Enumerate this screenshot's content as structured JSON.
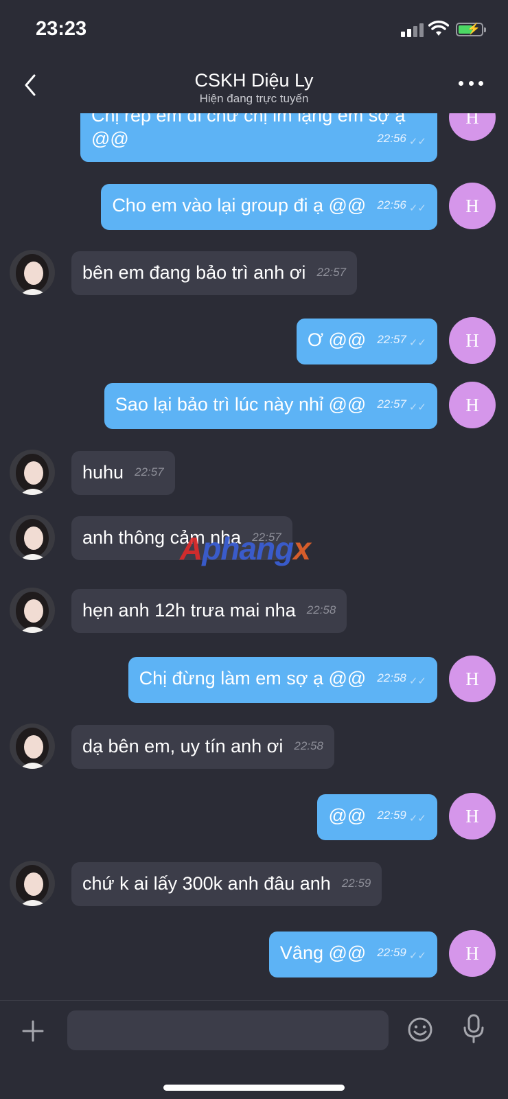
{
  "status_bar": {
    "time": "23:23"
  },
  "header": {
    "title": "CSKH Diệu Ly",
    "subtitle": "Hiện đang trực tuyến"
  },
  "messages": [
    {
      "side": "out",
      "text_line1": "Chị rep em đi chứ chị im lặng em sợ ạ",
      "text_line2": "@@",
      "time": "22:56",
      "avatar": "H"
    },
    {
      "side": "out",
      "text": "Cho em vào lại group đi ạ @@",
      "time": "22:56",
      "avatar": "H"
    },
    {
      "side": "in",
      "text": "bên em đang bảo trì anh ơi",
      "time": "22:57"
    },
    {
      "side": "out",
      "text": "Ơ @@",
      "time": "22:57",
      "avatar": "H"
    },
    {
      "side": "out",
      "text": "Sao lại bảo trì lúc này nhỉ @@",
      "time": "22:57",
      "avatar": "H"
    },
    {
      "side": "in",
      "text": "huhu",
      "time": "22:57"
    },
    {
      "side": "in",
      "text": "anh thông cảm nha",
      "time": "22:57"
    },
    {
      "side": "in",
      "text": "hẹn anh 12h trưa mai nha",
      "time": "22:58"
    },
    {
      "side": "out",
      "text": "Chị đừng làm em sợ ạ @@",
      "time": "22:58",
      "avatar": "H"
    },
    {
      "side": "in",
      "text": "dạ bên em, uy tín anh ơi",
      "time": "22:58"
    },
    {
      "side": "out",
      "text": "@@",
      "time": "22:59",
      "avatar": "H"
    },
    {
      "side": "in",
      "text": "chứ k ai lấy 300k anh đâu anh",
      "time": "22:59"
    },
    {
      "side": "out",
      "text": "Vâng @@",
      "time": "22:59",
      "avatar": "H"
    }
  ],
  "watermark": {
    "part1": "A",
    "part2": "phang",
    "part3": "x"
  },
  "input": {
    "placeholder": ""
  },
  "colors": {
    "background": "#2b2c36",
    "outgoing_bubble": "#5db3f5",
    "incoming_bubble": "#3c3d49",
    "avatar_h": "#d596ea"
  },
  "icons": [
    "back-chevron-icon",
    "more-dots-icon",
    "plus-icon",
    "emoji-icon",
    "microphone-icon",
    "double-check-icon"
  ]
}
